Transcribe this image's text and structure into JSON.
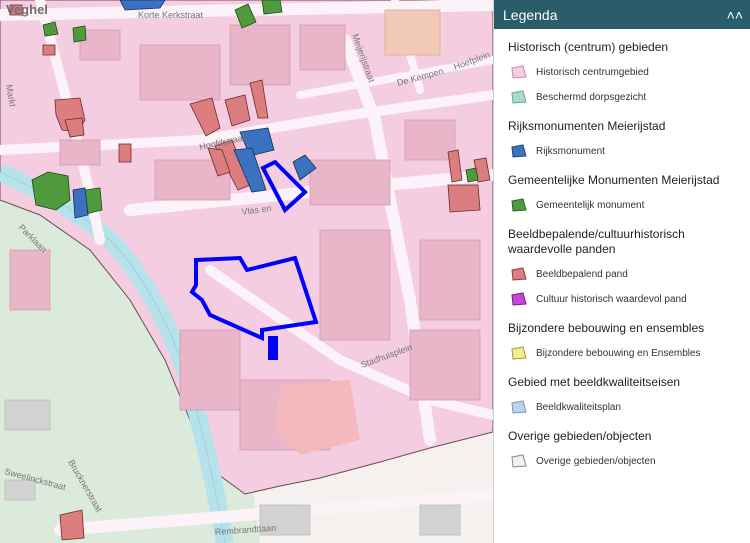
{
  "map": {
    "city_label": "Veghel",
    "streets": {
      "korte_kerkstraat": "Korte Kerkstraat",
      "markt": "Markt",
      "meijerijstraat": "Meijerijstraat",
      "de_kempen": "De Kempen",
      "hoefplein": "Hoefplein",
      "hoofdstraat": "Hoofdstraat",
      "vlas_en": "Vlas en",
      "parklaan": "Parklaan",
      "stadhuisplein": "Stadhuisplein",
      "sweelinckstraat": "Sweelinckstraat",
      "bruckner": "Brucknerstraat",
      "rembrandtlaan": "Rembrandtlaan"
    },
    "colors": {
      "historic_center": "#f5cde0",
      "monument": "#3b72c0",
      "municipal_monument": "#4e9a3c",
      "characteristic": "#dc7d80",
      "water": "#b6e2eb",
      "green": "#d7e8d7",
      "selection_outline": "#0000ff"
    }
  },
  "legend": {
    "title": "Legenda",
    "collapse_icon": "chevron-up-icon",
    "groups": [
      {
        "title": "Historisch (centrum) gebieden",
        "items": [
          {
            "label": "Historisch centrumgebied",
            "fill": "#f5cde0",
            "stroke": "#c890aa"
          },
          {
            "label": "Beschermd dorpsgezicht",
            "fill": "#a9dcc4",
            "stroke": "#6aa88c"
          }
        ]
      },
      {
        "title": "Rijksmonumenten Meierijstad",
        "items": [
          {
            "label": "Rijksmonument",
            "fill": "#3b72c0",
            "stroke": "#24498a"
          }
        ]
      },
      {
        "title": "Gemeentelijke Monumenten Meierijstad",
        "items": [
          {
            "label": "Gemeentelijk monument",
            "fill": "#4e9a3c",
            "stroke": "#2d6322"
          }
        ]
      },
      {
        "title": "Beeldbepalende/cultuurhistorisch waardevolle panden",
        "items": [
          {
            "label": "Beeldbepalend pand",
            "fill": "#dc7d80",
            "stroke": "#8a3c40"
          },
          {
            "label": "Cultuur historisch waardevol pand",
            "fill": "#c844d6",
            "stroke": "#7a1c88"
          }
        ]
      },
      {
        "title": "Bijzondere bebouwing en ensembles",
        "items": [
          {
            "label": "Bijzondere bebouwing en Ensembles",
            "fill": "#f5ec8c",
            "stroke": "#a09850"
          }
        ]
      },
      {
        "title": "Gebied met beeldkwaliteitseisen",
        "items": [
          {
            "label": "Beeldkwaliteitsplan",
            "fill": "#b9d2f0",
            "stroke": "#7d95b5"
          }
        ]
      },
      {
        "title": "Overige gebieden/objecten",
        "items": [
          {
            "label": "Overige gebieden/objecten",
            "fill": "#f2f2f2",
            "stroke": "#888888"
          }
        ]
      }
    ]
  }
}
